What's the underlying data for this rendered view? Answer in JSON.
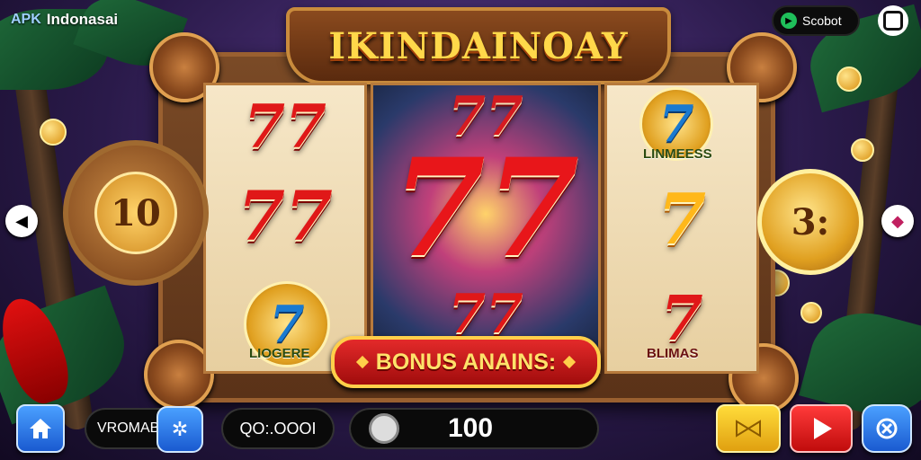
{
  "header": {
    "apk_badge": "APK",
    "site_name": "Indonasai",
    "game_title": "IKINDAINOAY",
    "social_label": "Scobot"
  },
  "reels": {
    "left": [
      "77",
      "77"
    ],
    "left_badge": {
      "symbol": "7",
      "caption": "LIOGERE"
    },
    "center_big": "77",
    "center_top": "77",
    "center_bottom": "77",
    "right_badge": {
      "symbol": "7",
      "caption": "LINMEESS"
    },
    "right_mid": "7",
    "right_bottom": {
      "symbol": "7",
      "caption": "BLIMAS"
    }
  },
  "side_coins": {
    "left_value": "10",
    "right_value": "3:"
  },
  "bonus_bar": {
    "label": "BONUS ANAINS:"
  },
  "bottom_bar": {
    "left_field": "VROMABF",
    "middle_field": "QO:.OOOI",
    "bet_value": "100"
  },
  "colors": {
    "accent_gold": "#ffd84a",
    "bonus_red": "#e42a2a",
    "spin_red": "#ff3a3a",
    "button_blue": "#1a5ad0"
  },
  "icons": [
    "home-icon",
    "settings-icon",
    "bet-knob-icon",
    "auto-play-icon",
    "play-icon",
    "spin-icon",
    "back-arrow-icon",
    "forward-arrow-icon",
    "social-icon",
    "menu-icon"
  ]
}
